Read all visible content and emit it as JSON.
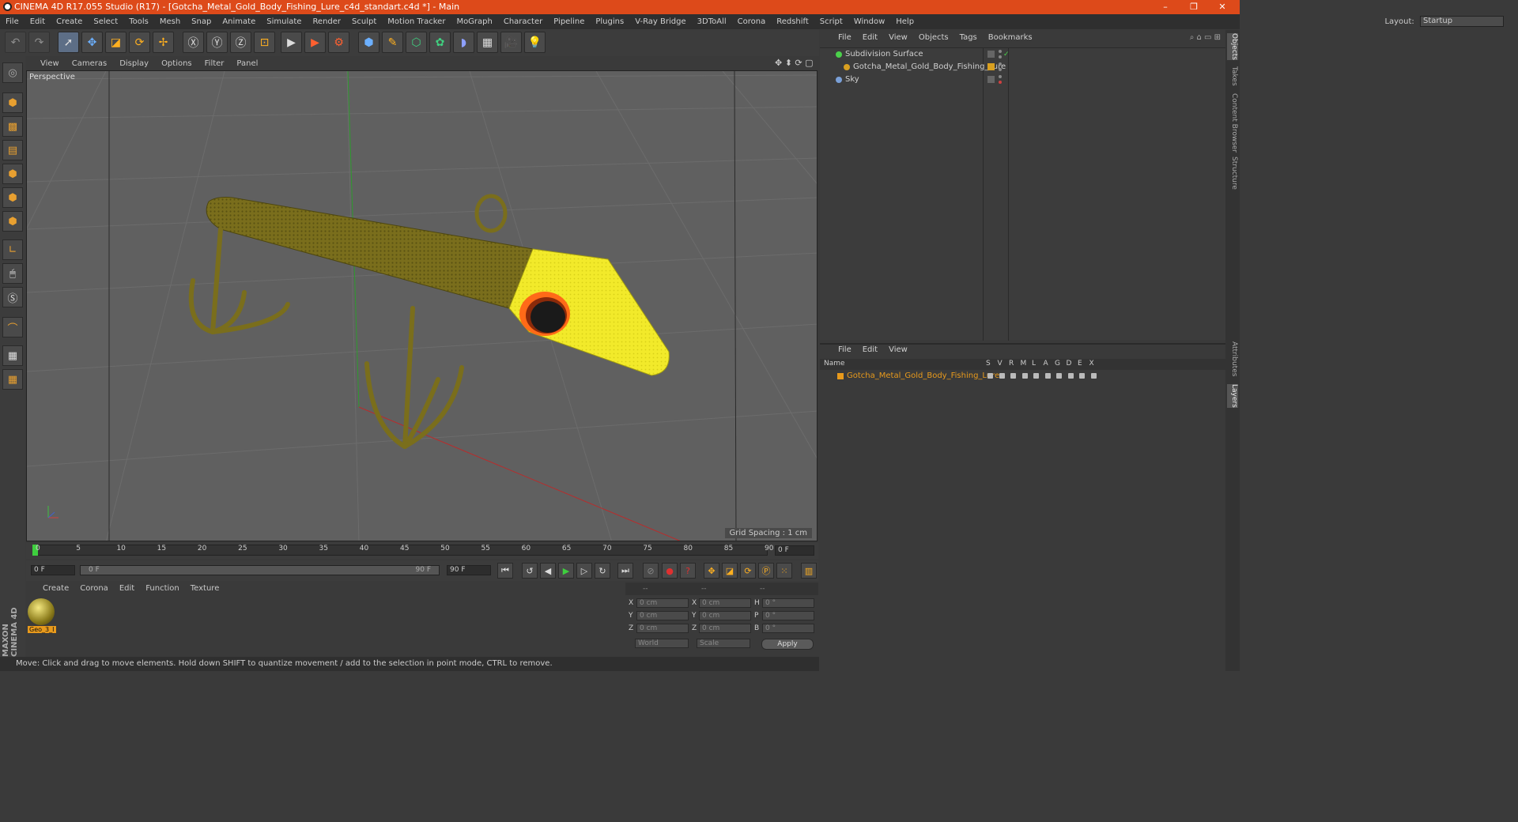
{
  "window": {
    "title": "CINEMA 4D R17.055 Studio (R17) - [Gotcha_Metal_Gold_Body_Fishing_Lure_c4d_standart.c4d *] - Main",
    "minimize": "–",
    "restore": "❐",
    "close": "✕"
  },
  "menu": [
    "File",
    "Edit",
    "Create",
    "Select",
    "Tools",
    "Mesh",
    "Snap",
    "Animate",
    "Simulate",
    "Render",
    "Sculpt",
    "Motion Tracker",
    "MoGraph",
    "Character",
    "Pipeline",
    "Plugins",
    "V-Ray Bridge",
    "3DToAll",
    "Corona",
    "Redshift",
    "Script",
    "Window",
    "Help"
  ],
  "layout": {
    "label": "Layout:",
    "value": "Startup"
  },
  "viewport": {
    "menu": [
      "View",
      "Cameras",
      "Display",
      "Options",
      "Filter",
      "Panel"
    ],
    "label": "Perspective",
    "grid_spacing": "Grid Spacing : 1 cm"
  },
  "timeline": {
    "ticks": [
      "0",
      "5",
      "10",
      "15",
      "20",
      "25",
      "30",
      "35",
      "40",
      "45",
      "50",
      "55",
      "60",
      "65",
      "70",
      "75",
      "80",
      "85",
      "90"
    ],
    "current_frame": "0 F",
    "start": "0 F",
    "range_start": "0 F",
    "range_end": "90 F",
    "end": "90 F"
  },
  "material_panel": {
    "menu": [
      "Create",
      "Corona",
      "Edit",
      "Function",
      "Texture"
    ],
    "material_name": "Geo_3_I"
  },
  "coordinates": {
    "header": [
      "--",
      "--",
      "--"
    ],
    "rows": [
      {
        "l1": "X",
        "v1": "0 cm",
        "l2": "X",
        "v2": "0 cm",
        "l3": "H",
        "v3": "0 °"
      },
      {
        "l1": "Y",
        "v1": "0 cm",
        "l2": "Y",
        "v2": "0 cm",
        "l3": "P",
        "v3": "0 °"
      },
      {
        "l1": "Z",
        "v1": "0 cm",
        "l2": "Z",
        "v2": "0 cm",
        "l3": "B",
        "v3": "0 °"
      }
    ],
    "world": "World",
    "scale": "Scale",
    "apply": "Apply"
  },
  "status": "Move: Click and drag to move elements. Hold down SHIFT to quantize movement / add to the selection in point mode, CTRL to remove.",
  "objects_panel": {
    "menu": [
      "File",
      "Edit",
      "View",
      "Objects",
      "Tags",
      "Bookmarks"
    ],
    "items": [
      {
        "name": "Subdivision Surface",
        "color": "#4bd14b"
      },
      {
        "name": "Gotcha_Metal_Gold_Body_Fishing_Lure",
        "color": "#d9a020"
      },
      {
        "name": "Sky",
        "color": "#7aa0d8"
      }
    ]
  },
  "layers_panel": {
    "menu": [
      "File",
      "Edit",
      "View"
    ],
    "columns": [
      "Name",
      "S",
      "V",
      "R",
      "M",
      "L",
      "A",
      "G",
      "D",
      "E",
      "X"
    ],
    "items": [
      {
        "name": "Gotcha_Metal_Gold_Body_Fishing_Lure",
        "color": "#e89a1c"
      }
    ]
  },
  "side_tabs": [
    "Objects",
    "Takes",
    "Content Browser",
    "Structure",
    "Attributes",
    "Layers"
  ],
  "maxon_logo": "MAXON CINEMA 4D"
}
